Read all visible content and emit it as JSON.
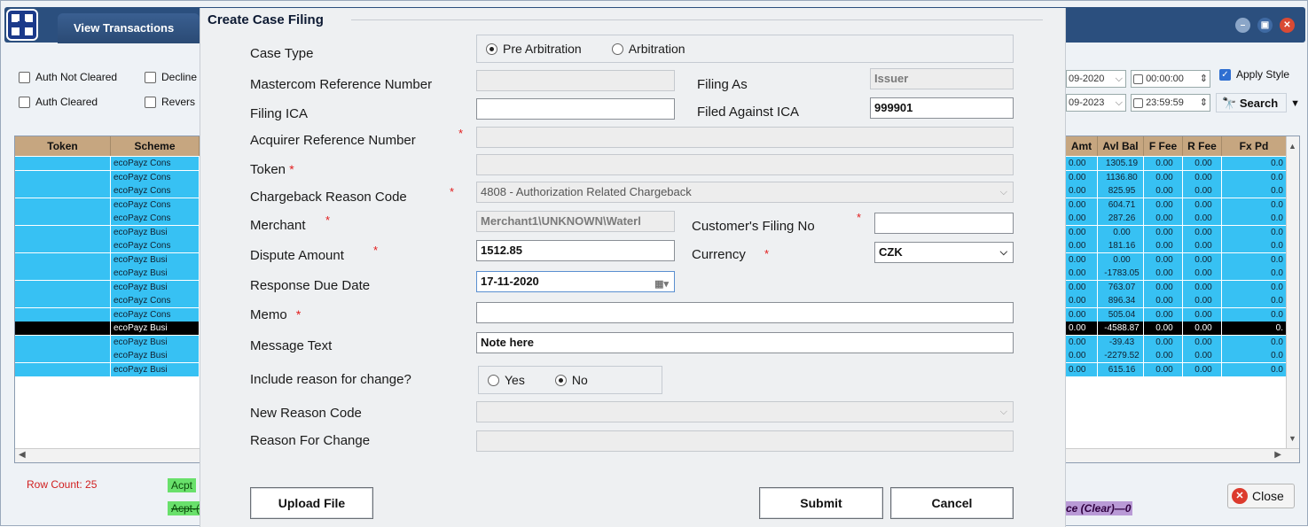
{
  "window": {
    "tab_label": "View Transactions",
    "controls": [
      "minimize",
      "restore",
      "close"
    ]
  },
  "filters": {
    "checkboxes": [
      {
        "label": "Auth Not Cleared",
        "checked": false
      },
      {
        "label": "Decline",
        "checked": false
      },
      {
        "label": "Auth Cleared",
        "checked": false
      },
      {
        "label": "Revers",
        "checked": false
      }
    ],
    "from_date": "09-2020",
    "from_time": "00:00:00",
    "to_date": "09-2023",
    "to_time": "23:59:59",
    "apply_style_label": "Apply Style",
    "apply_style_checked": true,
    "search_label": "Search"
  },
  "grid": {
    "left_headers": [
      "Token",
      "Scheme"
    ],
    "right_headers": [
      "Amt",
      "Avl Bal",
      "F Fee",
      "R Fee",
      "Fx Pd"
    ],
    "rows": [
      {
        "scheme": "ecoPayz Cons",
        "amt": "0.00",
        "avl": "1305.19",
        "ffee": "0.00",
        "rfee": "0.00",
        "fx": "0.0",
        "selected": false
      },
      {
        "scheme": "ecoPayz Cons",
        "amt": "0.00",
        "avl": "1136.80",
        "ffee": "0.00",
        "rfee": "0.00",
        "fx": "0.0",
        "selected": false
      },
      {
        "scheme": "ecoPayz Cons",
        "amt": "0.00",
        "avl": "825.95",
        "ffee": "0.00",
        "rfee": "0.00",
        "fx": "0.0",
        "selected": false
      },
      {
        "scheme": "ecoPayz Cons",
        "amt": "0.00",
        "avl": "604.71",
        "ffee": "0.00",
        "rfee": "0.00",
        "fx": "0.0",
        "selected": false
      },
      {
        "scheme": "ecoPayz Cons",
        "amt": "0.00",
        "avl": "287.26",
        "ffee": "0.00",
        "rfee": "0.00",
        "fx": "0.0",
        "selected": false
      },
      {
        "scheme": "ecoPayz Busi",
        "amt": "0.00",
        "avl": "0.00",
        "ffee": "0.00",
        "rfee": "0.00",
        "fx": "0.0",
        "selected": false
      },
      {
        "scheme": "ecoPayz Cons",
        "amt": "0.00",
        "avl": "181.16",
        "ffee": "0.00",
        "rfee": "0.00",
        "fx": "0.0",
        "selected": false
      },
      {
        "scheme": "ecoPayz Busi",
        "amt": "0.00",
        "avl": "0.00",
        "ffee": "0.00",
        "rfee": "0.00",
        "fx": "0.0",
        "selected": false
      },
      {
        "scheme": "ecoPayz Busi",
        "amt": "0.00",
        "avl": "-1783.05",
        "ffee": "0.00",
        "rfee": "0.00",
        "fx": "0.0",
        "selected": false
      },
      {
        "scheme": "ecoPayz Busi",
        "amt": "0.00",
        "avl": "763.07",
        "ffee": "0.00",
        "rfee": "0.00",
        "fx": "0.0",
        "selected": false
      },
      {
        "scheme": "ecoPayz Cons",
        "amt": "0.00",
        "avl": "896.34",
        "ffee": "0.00",
        "rfee": "0.00",
        "fx": "0.0",
        "selected": false
      },
      {
        "scheme": "ecoPayz Cons",
        "amt": "0.00",
        "avl": "505.04",
        "ffee": "0.00",
        "rfee": "0.00",
        "fx": "0.0",
        "selected": false
      },
      {
        "scheme": "ecoPayz Busi",
        "amt": "0.00",
        "avl": "-4588.87",
        "ffee": "0.00",
        "rfee": "0.00",
        "fx": "0.",
        "selected": true
      },
      {
        "scheme": "ecoPayz Busi",
        "amt": "0.00",
        "avl": "-39.43",
        "ffee": "0.00",
        "rfee": "0.00",
        "fx": "0.0",
        "selected": false
      },
      {
        "scheme": "ecoPayz Busi",
        "amt": "0.00",
        "avl": "-2279.52",
        "ffee": "0.00",
        "rfee": "0.00",
        "fx": "0.0",
        "selected": false
      },
      {
        "scheme": "ecoPayz Busi",
        "amt": "0.00",
        "avl": "615.16",
        "ffee": "0.00",
        "rfee": "0.00",
        "fx": "0.0",
        "selected": false
      }
    ]
  },
  "footer": {
    "row_count": "Row Count: 25",
    "acpt_1": "Acpt",
    "acpt_2": "Acpt-(",
    "balance_text": "ce (Clear)—0",
    "close_label": "Close"
  },
  "modal": {
    "title": "Create Case Filing",
    "case_type_label": "Case Type",
    "case_type_options": [
      "Pre Arbitration",
      "Arbitration"
    ],
    "case_type_selected": "Pre Arbitration",
    "mastercom_label": "Mastercom Reference Number",
    "mastercom_value": "",
    "filing_as_label": "Filing As",
    "filing_as_value": "Issuer",
    "filing_ica_label": "Filing ICA",
    "filing_ica_value": "",
    "filed_against_label": "Filed Against ICA",
    "filed_against_value": "999901",
    "arn_label": "Acquirer Reference Number",
    "arn_value": "",
    "token_label": "Token",
    "token_value": "",
    "cb_reason_label": "Chargeback Reason Code",
    "cb_reason_value": "4808 - Authorization Related Chargeback",
    "merchant_label": "Merchant",
    "merchant_value": "Merchant1\\UNKNOWN\\Waterl",
    "customer_filing_label": "Customer's Filing No",
    "customer_filing_value": "",
    "dispute_label": "Dispute Amount",
    "dispute_value": "1512.85",
    "currency_label": "Currency",
    "currency_value": "CZK",
    "response_due_label": "Response Due Date",
    "response_due_value": "17-11-2020",
    "memo_label": "Memo",
    "memo_value": "",
    "message_label": "Message Text",
    "message_value": "Note here",
    "include_reason_label": "Include reason for change?",
    "include_reason_options": [
      "Yes",
      "No"
    ],
    "include_reason_selected": "No",
    "new_reason_label": "New Reason Code",
    "new_reason_value": "",
    "reason_change_label": "Reason For Change",
    "reason_change_value": "",
    "upload_label": "Upload File",
    "submit_label": "Submit",
    "cancel_label": "Cancel",
    "required_marker": "*"
  }
}
